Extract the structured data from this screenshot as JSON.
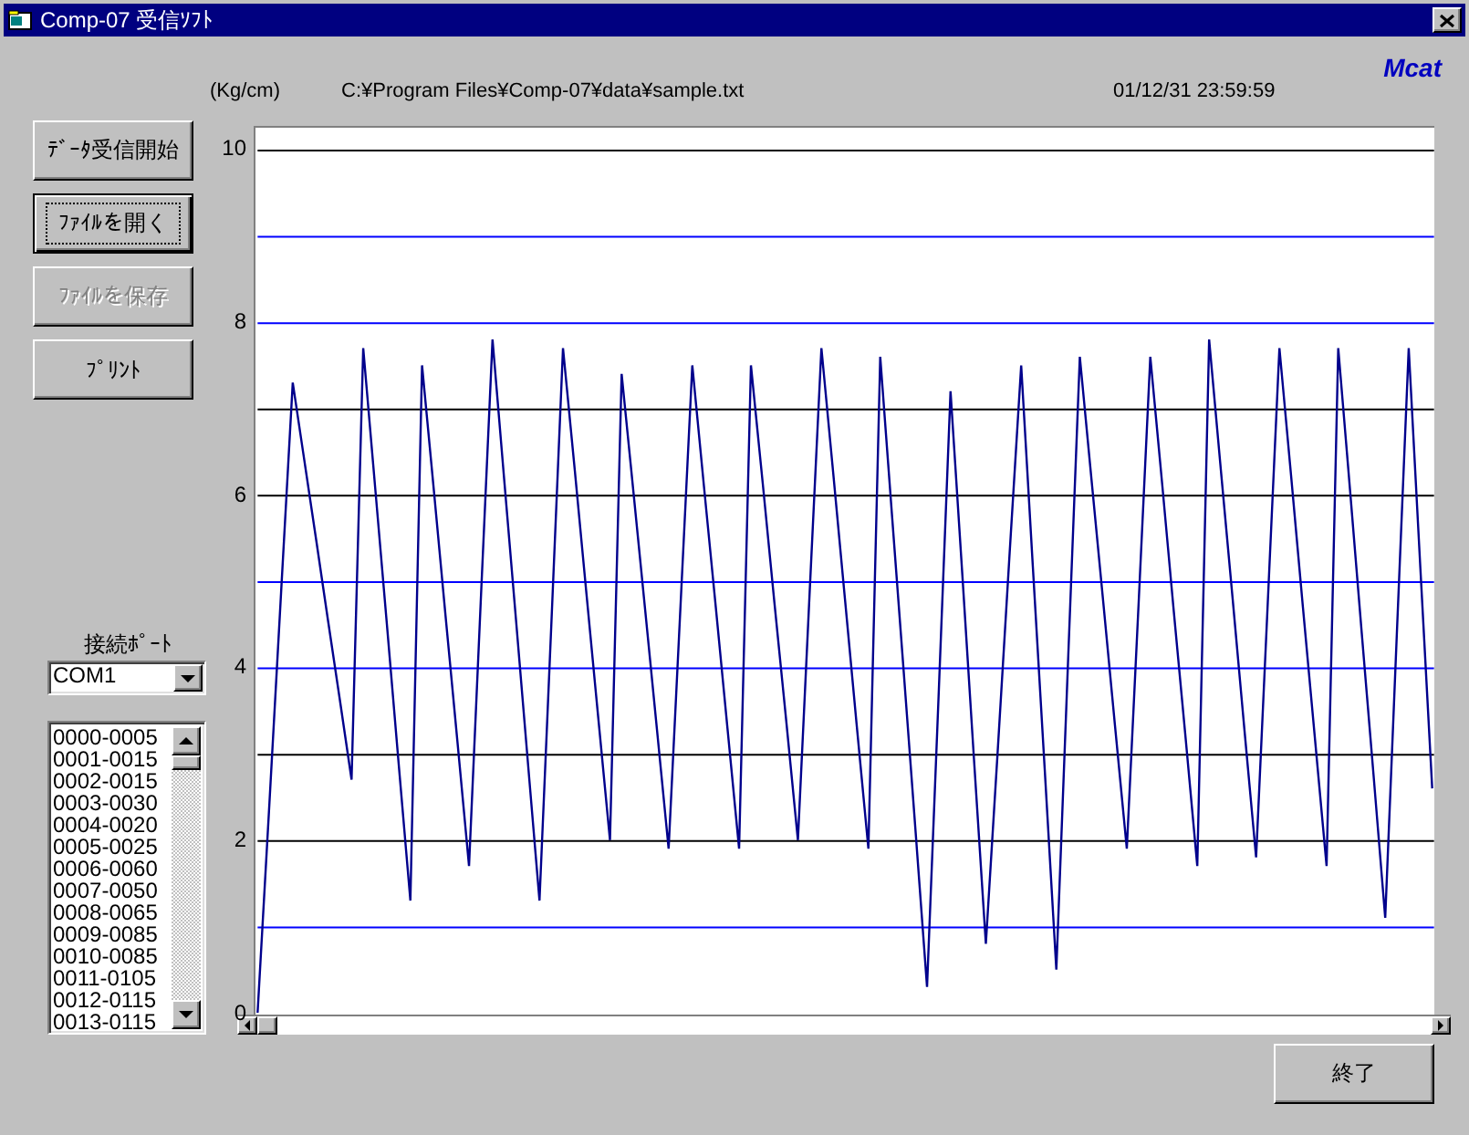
{
  "window": {
    "title": "Comp-07 受信ｿﾌﾄ"
  },
  "brand": "Mcat",
  "file_path": "C:¥Program Files¥Comp-07¥data¥sample.txt",
  "timestamp": "01/12/31 23:59:59",
  "buttons": [
    {
      "label": "ﾃﾞｰﾀ受信開始",
      "focused": false,
      "disabled": false
    },
    {
      "label": "ﾌｧｲﾙを開く",
      "focused": true,
      "disabled": false
    },
    {
      "label": "ﾌｧｲﾙを保存",
      "focused": false,
      "disabled": true
    },
    {
      "label": "ﾌﾟﾘﾝﾄ",
      "focused": false,
      "disabled": false
    }
  ],
  "port": {
    "label": "接続ﾎﾟｰﾄ",
    "value": "COM1"
  },
  "data_list": {
    "items": [
      "0000-0005",
      "0001-0015",
      "0002-0015",
      "0003-0030",
      "0004-0020",
      "0005-0025",
      "0006-0060",
      "0007-0050",
      "0008-0065",
      "0009-0085",
      "0010-0085",
      "0011-0105",
      "0012-0115",
      "0013-0115"
    ]
  },
  "chart": {
    "chart_data": {
      "type": "line",
      "grid": true,
      "ylabel": "(Kg/cm)",
      "ylim": [
        0,
        10
      ],
      "yticks": [
        0,
        2,
        4,
        6,
        8,
        10
      ],
      "categories": [
        null,
        null,
        null,
        null,
        null,
        null,
        null,
        null,
        null,
        null,
        null,
        null,
        null,
        null,
        null,
        null,
        null,
        null,
        null,
        null,
        null,
        null,
        null,
        null,
        null,
        null,
        null,
        null,
        null,
        null,
        null,
        null,
        null,
        null,
        null,
        null,
        null,
        null,
        null,
        null,
        null,
        null,
        null,
        null,
        null,
        null,
        null,
        null,
        null,
        null,
        null,
        null,
        null,
        null,
        null,
        null,
        null,
        null,
        null,
        null,
        null,
        null,
        null,
        null,
        null,
        null,
        null,
        null,
        null,
        null,
        null,
        null,
        null,
        null,
        null,
        null,
        null,
        null,
        null,
        null,
        null,
        null,
        null,
        null,
        null,
        null,
        null,
        null,
        null,
        null,
        null,
        null,
        null,
        null,
        null,
        null,
        null,
        null,
        null,
        null,
        null
      ],
      "series": [
        {
          "color": "#00008c",
          "values": [
            0,
            2.43,
            4.87,
            7.3,
            6.38,
            5.46,
            4.54,
            3.62,
            2.7,
            7.7,
            6.1,
            4.5,
            2.9,
            1.3,
            7.5,
            6.05,
            4.6,
            3.15,
            1.7,
            4.75,
            7.8,
            6.18,
            4.55,
            2.93,
            1.3,
            4.5,
            7.7,
            6.28,
            4.85,
            3.43,
            2.0,
            7.4,
            6.03,
            4.65,
            3.28,
            1.9,
            4.7,
            7.5,
            6.1,
            4.7,
            3.3,
            1.9,
            7.5,
            6.13,
            4.75,
            3.38,
            2.0,
            4.85,
            7.7,
            6.25,
            4.8,
            3.35,
            1.9,
            7.6,
            5.78,
            3.95,
            2.13,
            0.3,
            3.75,
            7.2,
            5.07,
            2.93,
            0.8,
            3.03,
            5.27,
            7.5,
            5.17,
            2.83,
            0.5,
            4.05,
            7.6,
            6.18,
            4.75,
            3.33,
            1.9,
            4.75,
            7.6,
            6.13,
            4.65,
            3.18,
            1.7,
            7.8,
            6.3,
            4.8,
            3.3,
            1.8,
            4.75,
            7.7,
            6.2,
            4.7,
            3.2,
            1.7,
            7.7,
            6.05,
            4.4,
            2.75,
            1.1,
            4.4,
            7.7,
            5.15,
            2.6
          ]
        }
      ]
    }
  },
  "exit_button": {
    "label": "終了"
  }
}
